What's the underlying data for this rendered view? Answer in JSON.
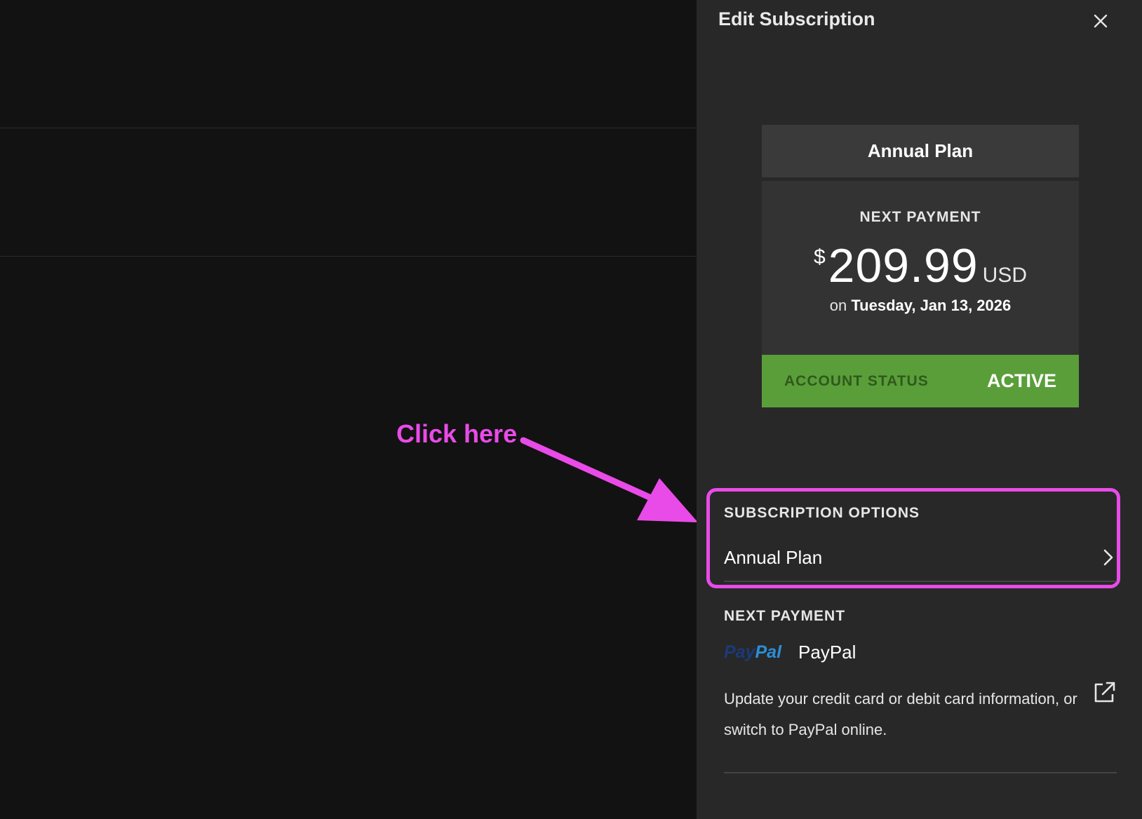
{
  "panel": {
    "title": "Edit Subscription",
    "close_icon": "close-icon"
  },
  "plan_card": {
    "plan_name": "Annual Plan",
    "next_payment_label": "NEXT PAYMENT",
    "currency_symbol": "$",
    "amount": "209.99",
    "currency_code": "USD",
    "date_prefix": "on",
    "date": "Tuesday, Jan 13, 2026",
    "status_label": "ACCOUNT STATUS",
    "status_value": "ACTIVE",
    "status_color": "#5a9e3a"
  },
  "subscription_options": {
    "label": "SUBSCRIPTION OPTIONS",
    "value": "Annual Plan",
    "chevron_icon": "chevron-right-icon"
  },
  "next_payment": {
    "label": "NEXT PAYMENT",
    "logo_pay": "Pay",
    "logo_pal": "Pal",
    "method_name": "PayPal",
    "update_text": "Update your credit card or debit card information, or switch to PayPal online.",
    "external_icon": "external-link-icon"
  },
  "annotation": {
    "text": "Click here",
    "color": "#e94be8"
  }
}
